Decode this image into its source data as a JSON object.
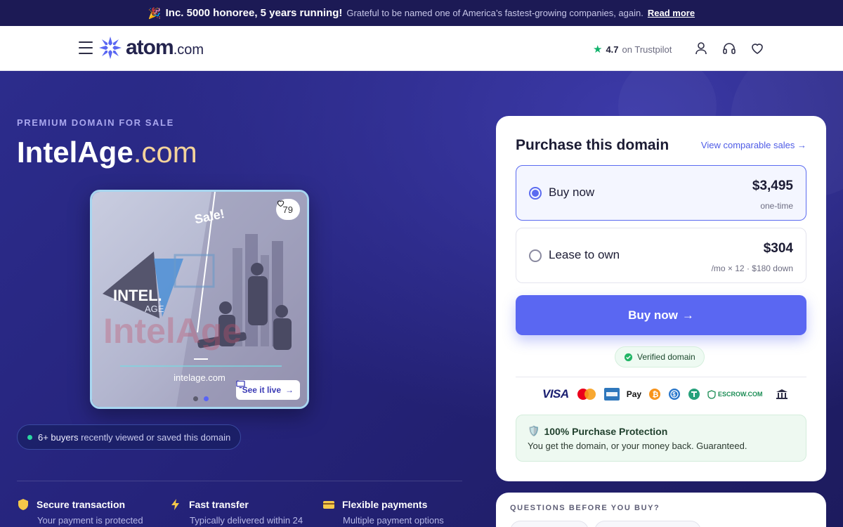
{
  "banner": {
    "headline": "Inc. 5000 honoree, 5 years running!",
    "subtext": "Grateful to be named one of America’s fastest-growing companies, again.",
    "link": "Read more"
  },
  "nav": {
    "logo_main": "atom",
    "logo_tld": ".com",
    "trust_rating": "4.7",
    "trust_label": "on Trustpilot"
  },
  "hero": {
    "eyebrow": "PREMIUM DOMAIN FOR SALE",
    "domain_name": "IntelAge",
    "domain_tld": ".com",
    "likes": "79",
    "see_live": "See it live",
    "preview_sale_badge": "Sale!",
    "preview_logo_line1": "INTEL.",
    "preview_logo_line2": "AGE",
    "preview_wordmark": "IntelAge",
    "preview_url": "intelage.com",
    "viewers_count": "6+ buyers",
    "viewers_text": "recently viewed or saved this domain"
  },
  "features": [
    {
      "title": "Secure transaction",
      "desc": "Your payment is protected"
    },
    {
      "title": "Fast transfer",
      "desc": "Typically delivered within 24"
    },
    {
      "title": "Flexible payments",
      "desc": "Multiple payment options"
    }
  ],
  "purchase": {
    "title": "Purchase this domain",
    "comparable_link": "View comparable sales",
    "options": [
      {
        "label": "Buy now",
        "price": "$3,495",
        "note": "one-time",
        "selected": true
      },
      {
        "label": "Lease to own",
        "price": "$304",
        "note": "/mo × 12 · $180 down",
        "selected": false
      }
    ],
    "cta": "Buy now",
    "verified": "Verified domain",
    "payment_methods": [
      "VISA",
      "mastercard",
      "amex",
      "Pay",
      "bitcoin",
      "usdc",
      "tether",
      "ESCROW.COM",
      "bank"
    ],
    "protection_title": "100% Purchase Protection",
    "protection_desc": "You get the domain, or your money back. Guaranteed."
  },
  "questions": {
    "title": "QUESTIONS BEFORE YOU BUY?"
  },
  "colors": {
    "accent": "#5a67f2",
    "hero_bg": "#25237a",
    "tld_gold": "#f3d39b",
    "success": "#10b26b"
  }
}
